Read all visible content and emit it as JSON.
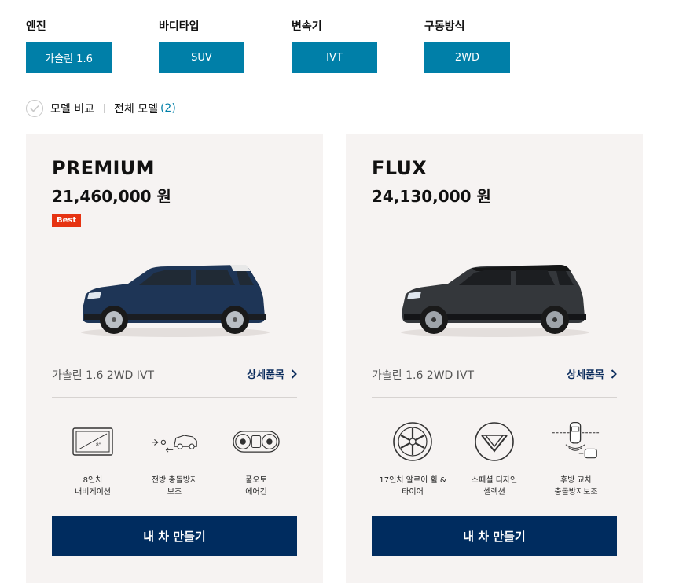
{
  "filters": [
    {
      "label": "엔진",
      "value": "가솔린 1.6"
    },
    {
      "label": "바디타입",
      "value": "SUV"
    },
    {
      "label": "변속기",
      "value": "IVT"
    },
    {
      "label": "구동방식",
      "value": "2WD"
    }
  ],
  "compare": {
    "label": "모델 비교",
    "all_models_label": "전체 모델",
    "count": "(2)"
  },
  "cards": [
    {
      "name": "PREMIUM",
      "price": "21,460,000 원",
      "badge": "Best",
      "car_color": "#1e3556",
      "spec": "가솔린 1.6 2WD IVT",
      "detail_label": "상세품목",
      "features": [
        {
          "icon": "navigation-screen-icon",
          "label": "8인치\n내비게이션"
        },
        {
          "icon": "forward-collision-icon",
          "label": "전방 충돌방지\n보조"
        },
        {
          "icon": "full-auto-aircon-icon",
          "label": "풀오토\n에어컨"
        }
      ],
      "build_label": "내 차 만들기"
    },
    {
      "name": "FLUX",
      "price": "24,130,000 원",
      "car_color": "#34373b",
      "spec": "가솔린 1.6 2WD IVT",
      "detail_label": "상세품목",
      "features": [
        {
          "icon": "alloy-wheel-icon",
          "label": "17인치 알로이 휠 &\n타이어"
        },
        {
          "icon": "design-selection-icon",
          "label": "스페셜 디자인\n셀렉션"
        },
        {
          "icon": "rear-cross-traffic-icon",
          "label": "후방 교차\n충돌방지보조"
        }
      ],
      "build_label": "내 차 만들기"
    }
  ]
}
